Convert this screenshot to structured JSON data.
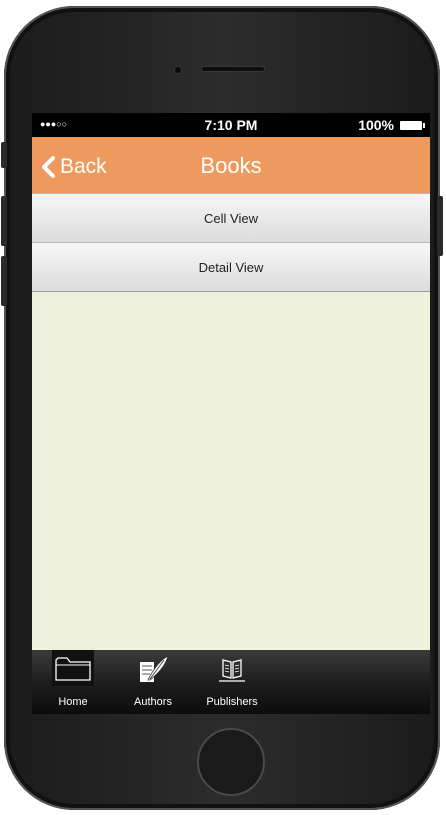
{
  "status_bar": {
    "signal": "●●●○○",
    "time": "7:10 PM",
    "battery": "100%"
  },
  "nav_bar": {
    "back_label": "Back",
    "title": "Books"
  },
  "list": {
    "items": [
      {
        "label": "Cell View"
      },
      {
        "label": "Detail View"
      }
    ]
  },
  "tab_bar": {
    "tabs": [
      {
        "label": "Home",
        "icon": "folder-icon",
        "active": true
      },
      {
        "label": "Authors",
        "icon": "quill-icon",
        "active": false
      },
      {
        "label": "Publishers",
        "icon": "book-icon",
        "active": false
      }
    ]
  },
  "colors": {
    "nav_bar": "#ee9a5e",
    "content_bg": "#eef2dc",
    "tab_bar": "#1e1e1e"
  }
}
